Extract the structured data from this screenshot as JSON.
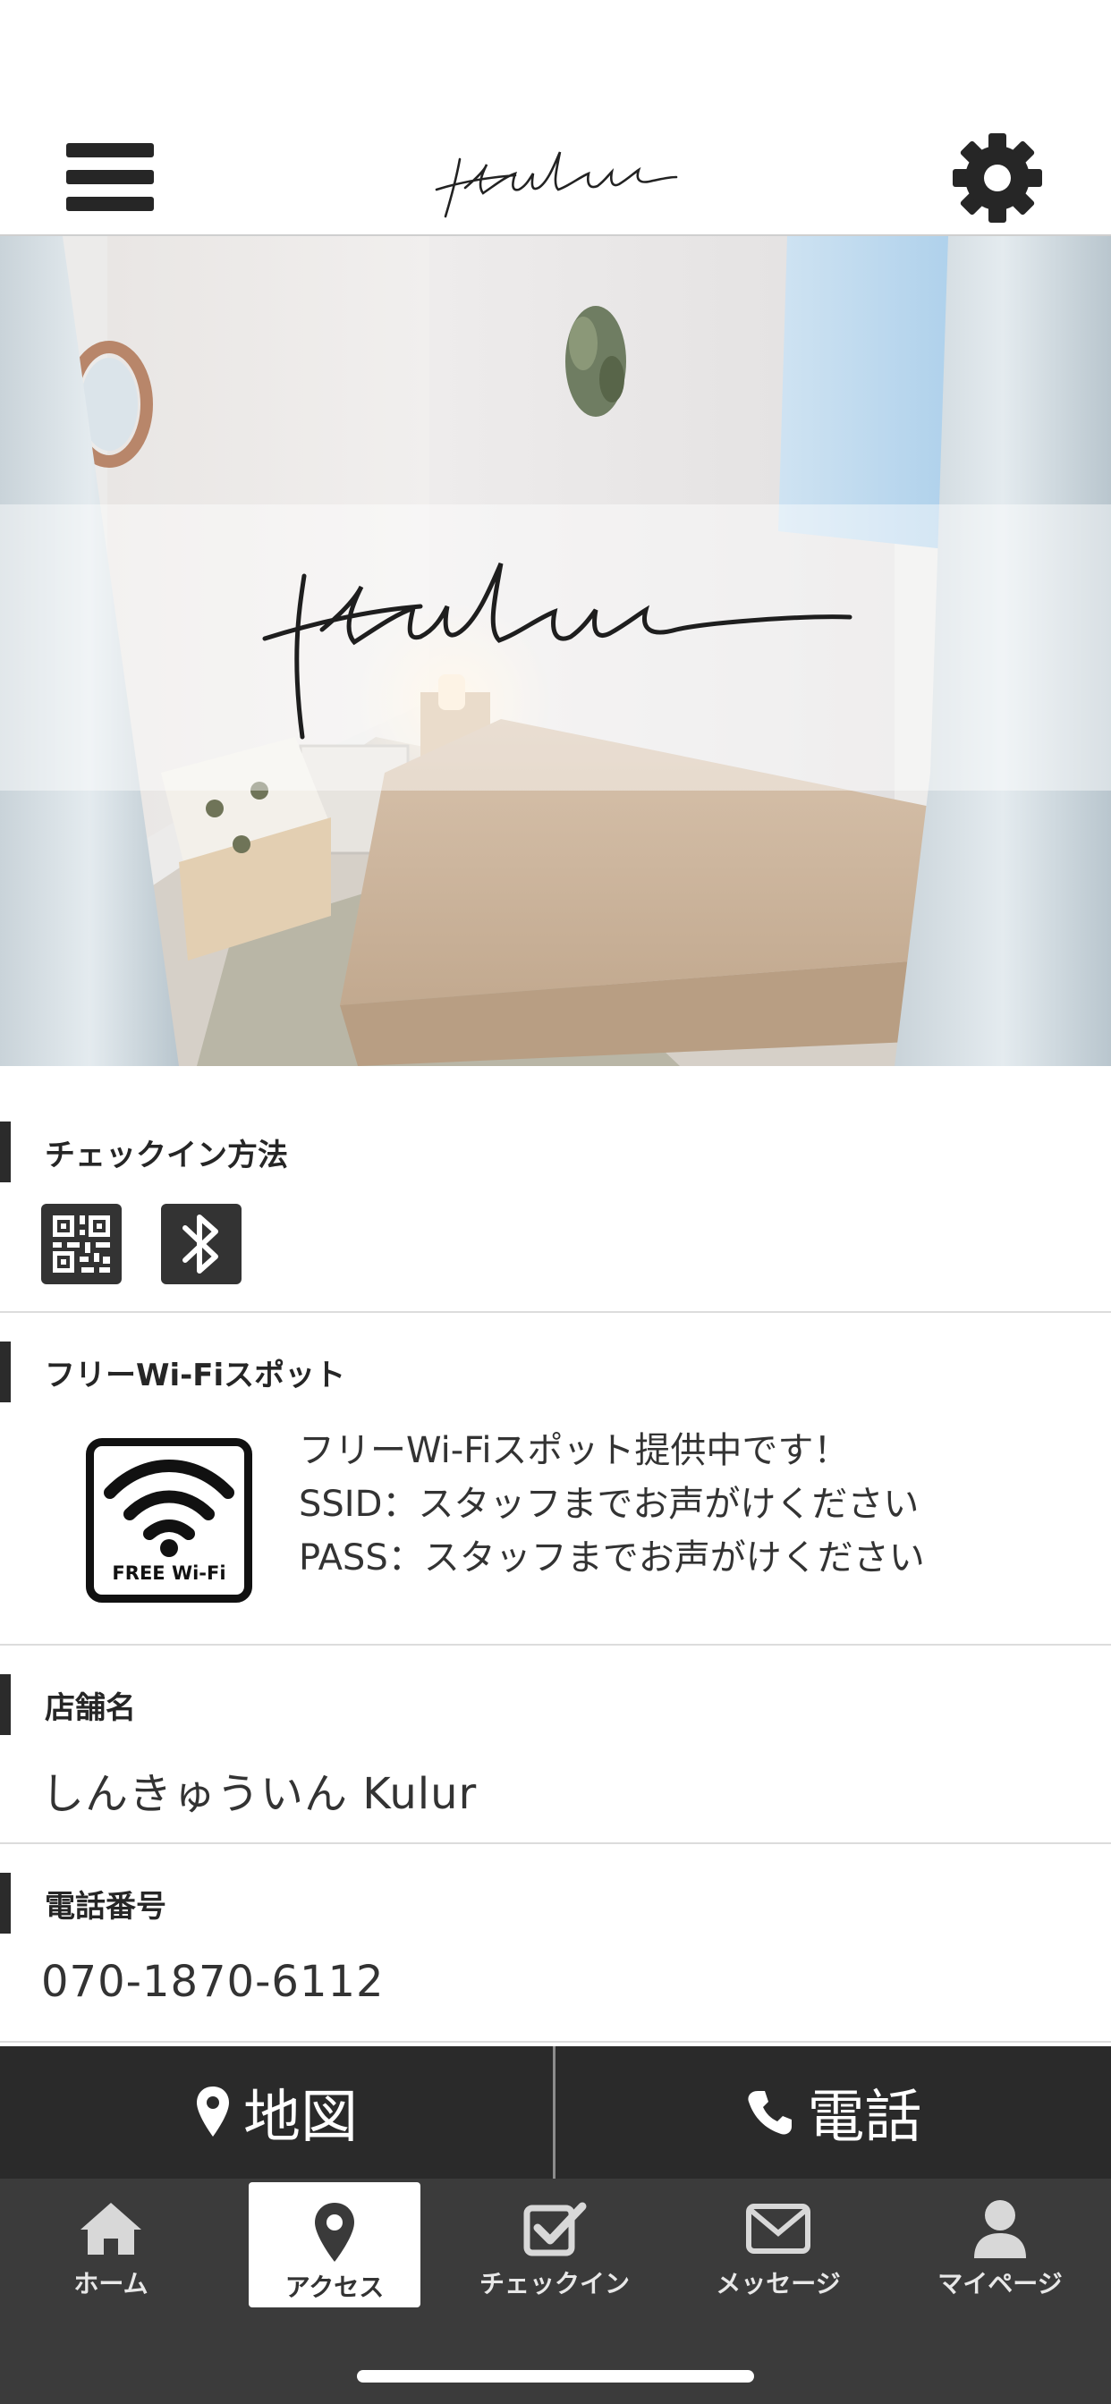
{
  "app": {
    "logo_text": "kulur"
  },
  "hero": {
    "logo_text": "kulur"
  },
  "sections": {
    "checkin": {
      "title": "チェックイン方法",
      "methods": [
        "qr-code",
        "bluetooth"
      ]
    },
    "wifi": {
      "title": "フリーWi-Fiスポット",
      "badge_label": "FREE Wi-Fi",
      "lines": [
        "フリーWi-Fiスポット提供中です！",
        "SSID：スタッフまでお声がけください",
        "PASS：スタッフまでお声がけください"
      ]
    },
    "store": {
      "title": "店舗名",
      "value": "しんきゅういん Kulur"
    },
    "phone": {
      "title": "電話番号",
      "value": "070-1870-6112"
    }
  },
  "actions": {
    "map_label": "地図",
    "call_label": "電話"
  },
  "tabs": [
    {
      "label": "ホーム",
      "icon": "home-icon"
    },
    {
      "label": "アクセス",
      "icon": "map-pin-icon",
      "active": true
    },
    {
      "label": "チェックイン",
      "icon": "checkbox-icon"
    },
    {
      "label": "メッセージ",
      "icon": "envelope-icon"
    },
    {
      "label": "マイページ",
      "icon": "user-icon"
    }
  ],
  "colors": {
    "dark_bar": "#2a2a2a",
    "tab_bar": "#3b3b3b",
    "accent": "#2b2b2b"
  }
}
